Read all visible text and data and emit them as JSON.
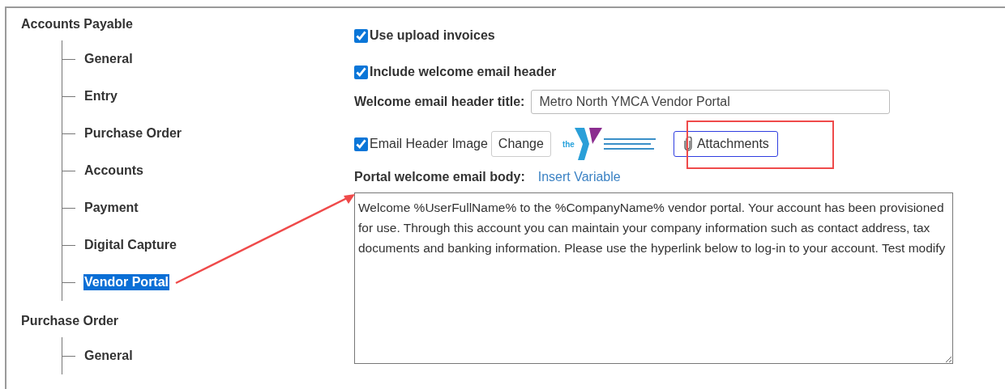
{
  "tree": [
    {
      "label": "Accounts Payable",
      "children": [
        {
          "label": "General",
          "selected": false
        },
        {
          "label": "Entry",
          "selected": false
        },
        {
          "label": "Purchase Order",
          "selected": false
        },
        {
          "label": "Accounts",
          "selected": false
        },
        {
          "label": "Payment",
          "selected": false
        },
        {
          "label": "Digital Capture",
          "selected": false
        },
        {
          "label": "Vendor Portal",
          "selected": true
        }
      ]
    },
    {
      "label": "Purchase Order",
      "children": [
        {
          "label": "General",
          "selected": false
        }
      ]
    }
  ],
  "settings": {
    "upload_invoices": {
      "label": "Use upload invoices",
      "checked": true
    },
    "welcome_header": {
      "label": "Include welcome email header",
      "checked": true
    },
    "header_title": {
      "label": "Welcome email header title:",
      "value": "Metro North YMCA Vendor Portal"
    },
    "header_image": {
      "label": "Email Header Image",
      "checked": true,
      "change_button": "Change",
      "logo_text": "the",
      "attachments_button": "Attachments"
    },
    "body": {
      "label": "Portal welcome email body:",
      "insert_link": "Insert Variable",
      "value": "Welcome %UserFullName% to the %CompanyName% vendor portal. Your account has been provisioned for use. Through this account you can maintain your company information such as contact address, tax documents and banking information. Please use the hyperlink below to log-in to your account. Test modify"
    }
  }
}
